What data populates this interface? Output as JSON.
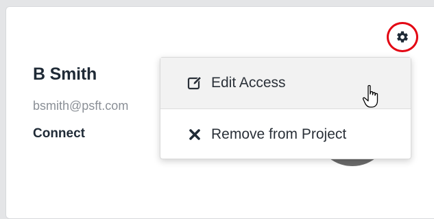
{
  "user": {
    "name": "B Smith",
    "email": "bsmith@psft.com",
    "role": "Connect"
  },
  "settings": {
    "icon": "gear-icon",
    "highlight_color": "#e30613"
  },
  "menu": {
    "items": [
      {
        "label": "Edit Access",
        "icon": "edit-icon",
        "state": "hovered"
      },
      {
        "label": "Remove from Project",
        "icon": "close-icon"
      }
    ]
  }
}
